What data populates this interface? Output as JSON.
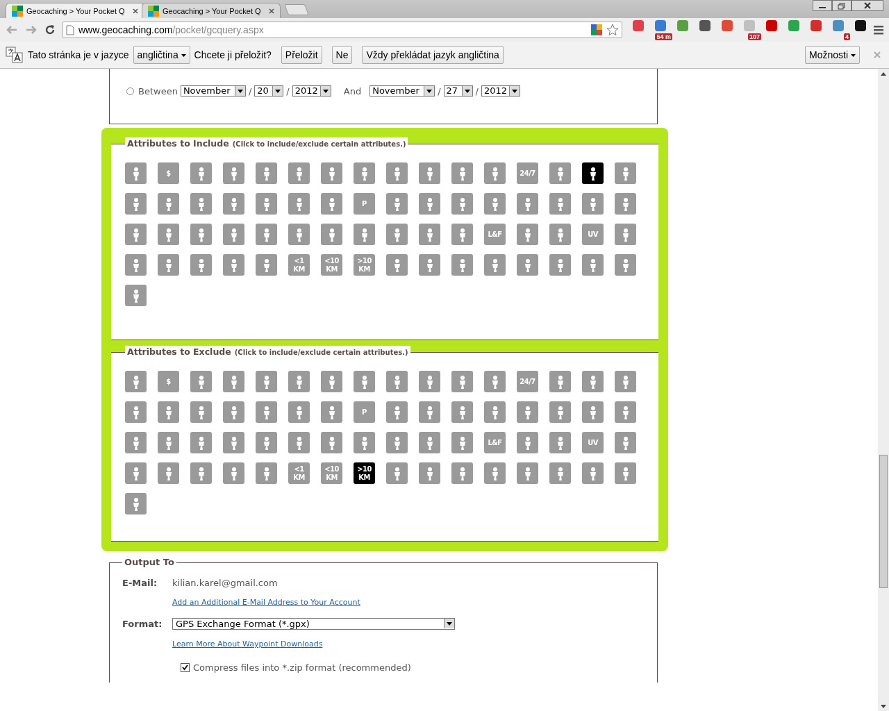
{
  "browser": {
    "tabs": [
      {
        "title": "Geocaching > Your Pocket Q",
        "selected": true
      },
      {
        "title": "Geocaching > Your Pocket Q",
        "selected": false
      }
    ],
    "url_host": "www.geocaching.com",
    "url_path": "/pocket/gcquery.aspx",
    "extensions": [
      {
        "color": "#e0404a"
      },
      {
        "color": "#3a7bd5",
        "badge": "54 m"
      },
      {
        "color": "#5aa040"
      },
      {
        "color": "#555555"
      },
      {
        "color": "#dd4b39"
      },
      {
        "color": "#c0c0c0",
        "badge": "107"
      },
      {
        "color": "#cc0000"
      },
      {
        "color": "#2ea44f"
      },
      {
        "color": "#d32f2f"
      },
      {
        "color": "#4a90c0",
        "badge": "4"
      },
      {
        "color": "#111111"
      }
    ]
  },
  "translate_bar": {
    "message": "Tato stránka je v jazyce",
    "language": "angličtina",
    "question": "Chcete ji přeložit?",
    "buttons": [
      "Přeložit",
      "Ne",
      "Vždy překládat jazyk angličtina"
    ],
    "options": "Možnosti"
  },
  "date_range": {
    "selected": false,
    "label": "Between",
    "from": {
      "month": "November",
      "separator_1": "/",
      "day": "20",
      "separator_2": "/",
      "year": "2012"
    },
    "and": "And",
    "to": {
      "month": "November",
      "separator_1": "/",
      "day": "27",
      "separator_2": "/",
      "year": "2012"
    }
  },
  "attributes_include": {
    "title": "Attributes to Include",
    "hint": "(Click to include/exclude certain attributes.)",
    "items": [
      {
        "selected": false
      },
      {
        "selected": false,
        "lines": [
          "$"
        ]
      },
      {
        "selected": false
      },
      {
        "selected": false
      },
      {
        "selected": false
      },
      {
        "selected": false
      },
      {
        "selected": false
      },
      {
        "selected": false
      },
      {
        "selected": false
      },
      {
        "selected": false
      },
      {
        "selected": false
      },
      {
        "selected": false
      },
      {
        "selected": false,
        "lines": [
          "24/7"
        ]
      },
      {
        "selected": false
      },
      {
        "selected": true
      },
      {
        "selected": false
      },
      {
        "selected": false
      },
      {
        "selected": false
      },
      {
        "selected": false
      },
      {
        "selected": false
      },
      {
        "selected": false
      },
      {
        "selected": false
      },
      {
        "selected": false
      },
      {
        "selected": false,
        "lines": [
          "P"
        ]
      },
      {
        "selected": false
      },
      {
        "selected": false
      },
      {
        "selected": false
      },
      {
        "selected": false
      },
      {
        "selected": false
      },
      {
        "selected": false
      },
      {
        "selected": false
      },
      {
        "selected": false
      },
      {
        "selected": false
      },
      {
        "selected": false
      },
      {
        "selected": false
      },
      {
        "selected": false
      },
      {
        "selected": false
      },
      {
        "selected": false
      },
      {
        "selected": false
      },
      {
        "selected": false
      },
      {
        "selected": false
      },
      {
        "selected": false
      },
      {
        "selected": false
      },
      {
        "selected": false,
        "lines": [
          "L&F"
        ]
      },
      {
        "selected": false
      },
      {
        "selected": false
      },
      {
        "selected": false,
        "lines": [
          "UV"
        ]
      },
      {
        "selected": false
      },
      {
        "selected": false
      },
      {
        "selected": false
      },
      {
        "selected": false
      },
      {
        "selected": false
      },
      {
        "selected": false
      },
      {
        "selected": false,
        "lines": [
          "<1",
          "KM"
        ]
      },
      {
        "selected": false,
        "lines": [
          "<10",
          "KM"
        ]
      },
      {
        "selected": false,
        "lines": [
          ">10",
          "KM"
        ]
      },
      {
        "selected": false
      },
      {
        "selected": false
      },
      {
        "selected": false
      },
      {
        "selected": false
      },
      {
        "selected": false
      },
      {
        "selected": false
      },
      {
        "selected": false
      },
      {
        "selected": false
      },
      {
        "selected": false
      }
    ]
  },
  "attributes_exclude": {
    "title": "Attributes to Exclude",
    "hint": "(Click to include/exclude certain attributes.)",
    "items": [
      {
        "selected": false
      },
      {
        "selected": false,
        "lines": [
          "$"
        ]
      },
      {
        "selected": false
      },
      {
        "selected": false
      },
      {
        "selected": false
      },
      {
        "selected": false
      },
      {
        "selected": false
      },
      {
        "selected": false
      },
      {
        "selected": false
      },
      {
        "selected": false
      },
      {
        "selected": false
      },
      {
        "selected": false
      },
      {
        "selected": false,
        "lines": [
          "24/7"
        ]
      },
      {
        "selected": false
      },
      {
        "selected": false
      },
      {
        "selected": false
      },
      {
        "selected": false
      },
      {
        "selected": false
      },
      {
        "selected": false
      },
      {
        "selected": false
      },
      {
        "selected": false
      },
      {
        "selected": false
      },
      {
        "selected": false
      },
      {
        "selected": false,
        "lines": [
          "P"
        ]
      },
      {
        "selected": false
      },
      {
        "selected": false
      },
      {
        "selected": false
      },
      {
        "selected": false
      },
      {
        "selected": false
      },
      {
        "selected": false
      },
      {
        "selected": false
      },
      {
        "selected": false
      },
      {
        "selected": false
      },
      {
        "selected": false
      },
      {
        "selected": false
      },
      {
        "selected": false
      },
      {
        "selected": false
      },
      {
        "selected": false
      },
      {
        "selected": false
      },
      {
        "selected": false
      },
      {
        "selected": false
      },
      {
        "selected": false
      },
      {
        "selected": false
      },
      {
        "selected": false,
        "lines": [
          "L&F"
        ]
      },
      {
        "selected": false
      },
      {
        "selected": false
      },
      {
        "selected": false,
        "lines": [
          "UV"
        ]
      },
      {
        "selected": false
      },
      {
        "selected": false
      },
      {
        "selected": false
      },
      {
        "selected": false
      },
      {
        "selected": false
      },
      {
        "selected": false
      },
      {
        "selected": false,
        "lines": [
          "<1",
          "KM"
        ]
      },
      {
        "selected": false,
        "lines": [
          "<10",
          "KM"
        ]
      },
      {
        "selected": true,
        "lines": [
          ">10",
          "KM"
        ]
      },
      {
        "selected": false
      },
      {
        "selected": false
      },
      {
        "selected": false
      },
      {
        "selected": false
      },
      {
        "selected": false
      },
      {
        "selected": false
      },
      {
        "selected": false
      },
      {
        "selected": false
      },
      {
        "selected": false
      }
    ]
  },
  "output": {
    "title": "Output To",
    "email_label": "E-Mail:",
    "email": "kilian.karel@gmail.com",
    "add_email_link": "Add an Additional E-Mail Address to Your Account",
    "format_label": "Format:",
    "format": "GPS Exchange Format (*.gpx)",
    "learn_link": "Learn More About Waypoint Downloads",
    "compress": {
      "checked": true,
      "label": "Compress files into *.zip format (recommended)"
    }
  }
}
